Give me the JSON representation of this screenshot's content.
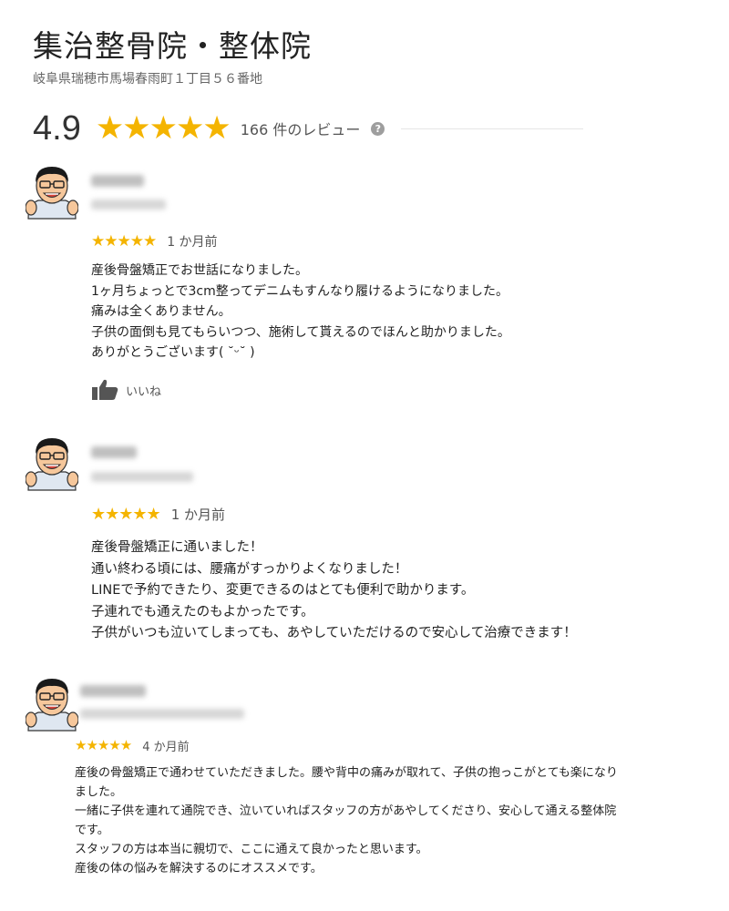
{
  "business": {
    "name": "集治整骨院・整体院",
    "address": "岐阜県瑞穂市馬場春雨町１丁目５６番地"
  },
  "rating": {
    "score": "4.9",
    "stars": "★★★★★",
    "count_label": "166 件のレビュー",
    "help_icon": "?"
  },
  "reviews": [
    {
      "stars": "★★★★★",
      "date": "1 か月前",
      "lines": [
        "産後骨盤矯正でお世話になりました。",
        "1ヶ月ちょっとで3cm整ってデニムもすんなり履けるようになりました。",
        "痛みは全くありません。",
        "子供の面倒も見てもらいつつ、施術して貰えるのでほんと助かりました。",
        "ありがとうございます( ˘ᵕ˘ )"
      ],
      "like_label": "いいね"
    },
    {
      "stars": "★★★★★",
      "date": "1 か月前",
      "lines": [
        "産後骨盤矯正に通いました！",
        "通い終わる頃には、腰痛がすっかりよくなりました！",
        "LINEで予約できたり、変更できるのはとても便利で助かります。",
        "子連れでも通えたのもよかったです。",
        "子供がいつも泣いてしまっても、あやしていただけるので安心して治療できます！"
      ]
    },
    {
      "stars": "★★★★★",
      "date": "4 か月前",
      "lines": [
        "産後の骨盤矯正で通わせていただきました。腰や背中の痛みが取れて、子供の抱っこがとても楽になり",
        "ました。",
        "一緒に子供を連れて通院でき、泣いていればスタッフの方があやしてくださり、安心して通える整体院",
        "です。",
        "スタッフの方は本当に親切で、ここに通えて良かったと思います。",
        "産後の体の悩みを解決するのにオススメです。"
      ]
    }
  ],
  "colors": {
    "star": "#f4b400",
    "avatar_skin": "#f6c79b",
    "avatar_hair": "#1a1a1a"
  },
  "icons": {
    "help": "help-circle-icon",
    "like": "thumbs-up-icon",
    "avatar": "cartoon-avatar-icon"
  }
}
